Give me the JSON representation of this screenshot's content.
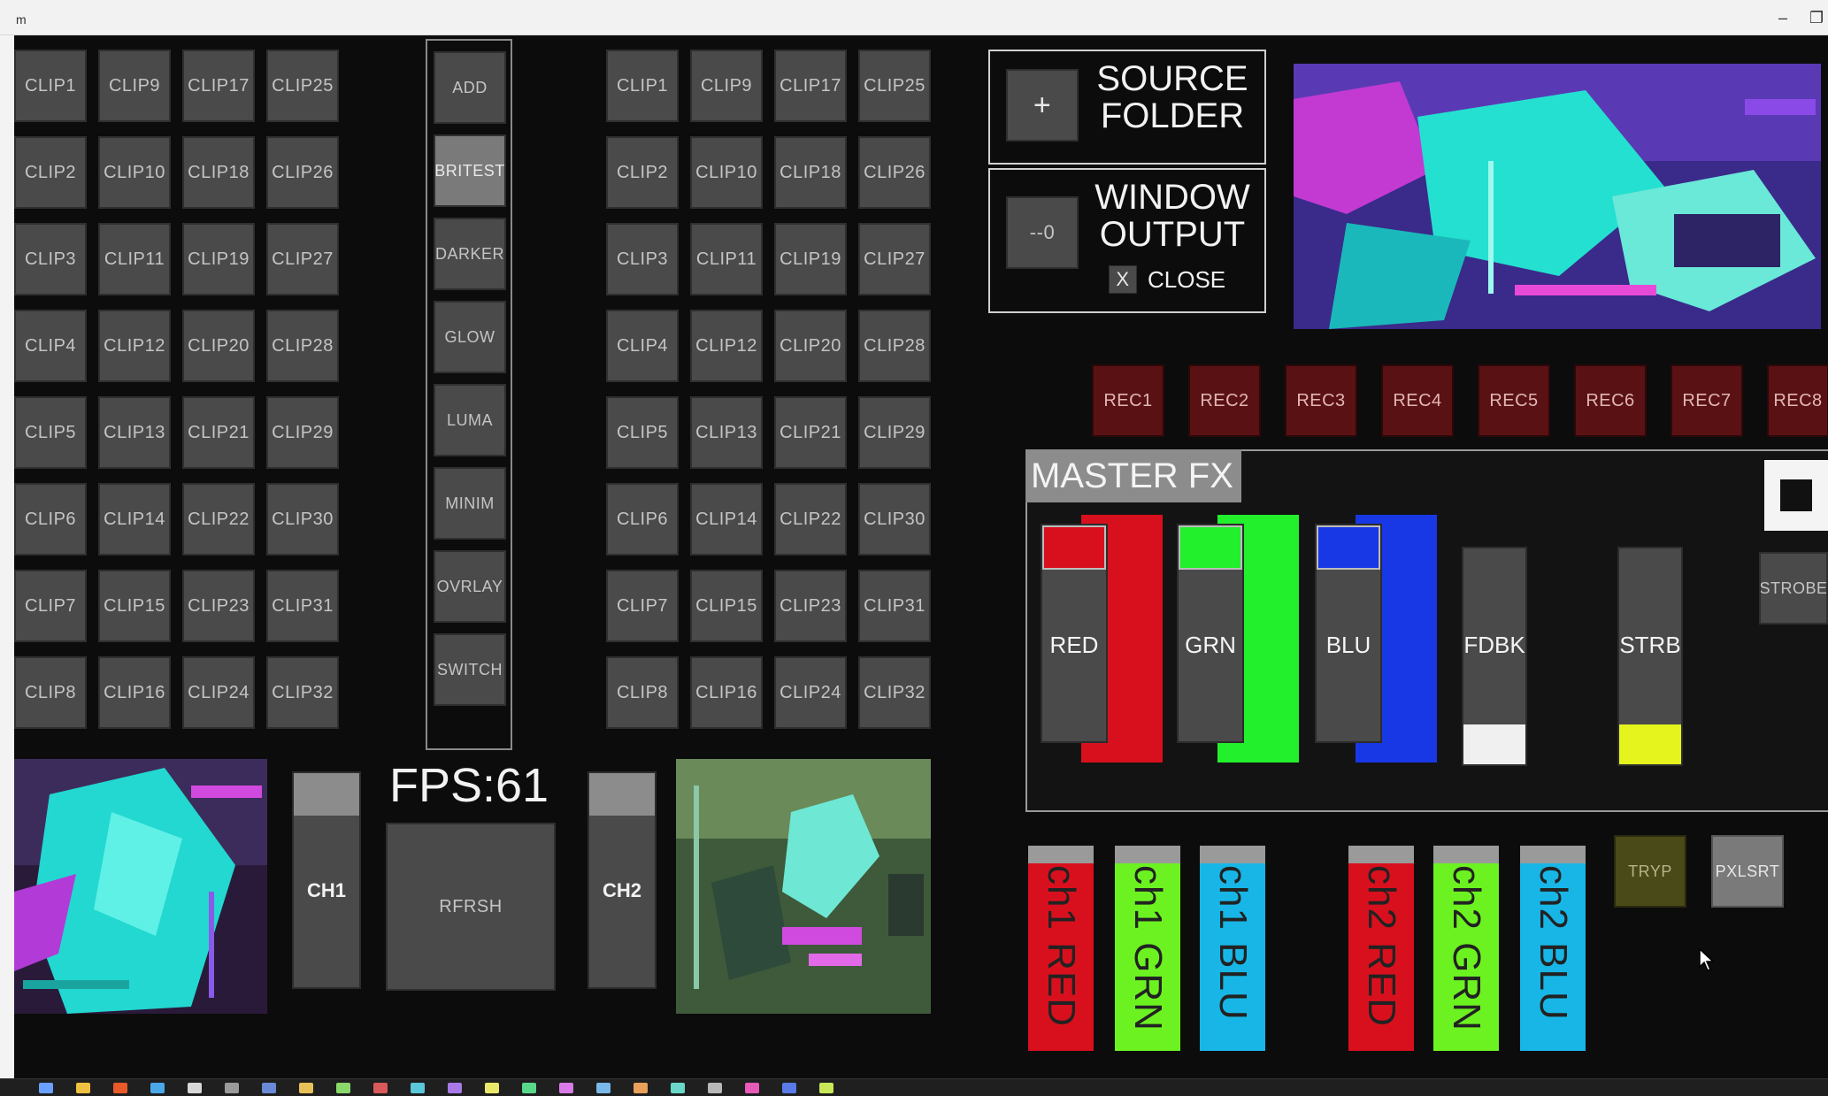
{
  "window": {
    "title": "m",
    "minimize_glyph": "–",
    "restore_glyph": "❐"
  },
  "clip_bank_left": {
    "columns": [
      [
        "CLIP1",
        "CLIP2",
        "CLIP3",
        "CLIP4",
        "CLIP5",
        "CLIP6",
        "CLIP7",
        "CLIP8"
      ],
      [
        "CLIP9",
        "CLIP10",
        "CLIP11",
        "CLIP12",
        "CLIP13",
        "CLIP14",
        "CLIP15",
        "CLIP16"
      ],
      [
        "CLIP17",
        "CLIP18",
        "CLIP19",
        "CLIP20",
        "CLIP21",
        "CLIP22",
        "CLIP23",
        "CLIP24"
      ],
      [
        "CLIP25",
        "CLIP26",
        "CLIP27",
        "CLIP28",
        "CLIP29",
        "CLIP30",
        "CLIP31",
        "CLIP32"
      ]
    ]
  },
  "clip_bank_right": {
    "columns": [
      [
        "CLIP1",
        "CLIP2",
        "CLIP3",
        "CLIP4",
        "CLIP5",
        "CLIP6",
        "CLIP7",
        "CLIP8"
      ],
      [
        "CLIP9",
        "CLIP10",
        "CLIP11",
        "CLIP12",
        "CLIP13",
        "CLIP14",
        "CLIP15",
        "CLIP16"
      ],
      [
        "CLIP17",
        "CLIP18",
        "CLIP19",
        "CLIP20",
        "CLIP21",
        "CLIP22",
        "CLIP23",
        "CLIP24"
      ],
      [
        "CLIP25",
        "CLIP26",
        "CLIP27",
        "CLIP28",
        "CLIP29",
        "CLIP30",
        "CLIP31",
        "CLIP32"
      ]
    ]
  },
  "blend_modes": [
    {
      "label": "ADD",
      "active": false
    },
    {
      "label": "BRITEST",
      "active": true
    },
    {
      "label": "DARKER",
      "active": false
    },
    {
      "label": "GLOW",
      "active": false
    },
    {
      "label": "LUMA",
      "active": false
    },
    {
      "label": "MINIM",
      "active": false
    },
    {
      "label": "OVRLAY",
      "active": false
    },
    {
      "label": "SWITCH",
      "active": false
    }
  ],
  "fps": "FPS:61",
  "channels": {
    "ch1": "CH1",
    "ch2": "CH2",
    "refresh": "RFRSH"
  },
  "source_folder": {
    "icon": "+",
    "label_line1": "SOURCE",
    "label_line2": "FOLDER"
  },
  "window_output": {
    "value": "--0",
    "label_line1": "WINDOW",
    "label_line2": "OUTPUT",
    "close_icon": "X",
    "close_label": "CLOSE"
  },
  "rec_buttons": [
    "REC1",
    "REC2",
    "REC3",
    "REC4",
    "REC5",
    "REC6",
    "REC7",
    "REC8"
  ],
  "master_fx": {
    "title": "MASTER FX",
    "sliders": [
      {
        "label": "RED",
        "color": "#d8101d",
        "level": 1.0
      },
      {
        "label": "GRN",
        "color": "#22f02c",
        "level": 1.0
      },
      {
        "label": "BLU",
        "color": "#1838e6",
        "level": 1.0
      },
      {
        "label": "FDBK",
        "color": "#f0f0f0",
        "level": 0.18
      },
      {
        "label": "STRB",
        "color": "#e4f41c",
        "level": 0.18
      }
    ],
    "strobe_button": "STROBE"
  },
  "channel_color_bars": [
    {
      "label": "ch1 RED",
      "color": "#d8101d"
    },
    {
      "label": "ch1 GRN",
      "color": "#6cf221"
    },
    {
      "label": "ch1 BLU",
      "color": "#18b6e6"
    },
    {
      "label": "ch2 RED",
      "color": "#d8101d"
    },
    {
      "label": "ch2 GRN",
      "color": "#6cf221"
    },
    {
      "label": "ch2 BLU",
      "color": "#18b6e6"
    }
  ],
  "extra_buttons": {
    "tryp": "TRYP",
    "pxlsrt": "PXLSRT"
  },
  "colors": {
    "background": "#0c0c0c",
    "button": "#4a4a4a",
    "rec": "#5a1114",
    "tryp": "#4a4a18"
  }
}
